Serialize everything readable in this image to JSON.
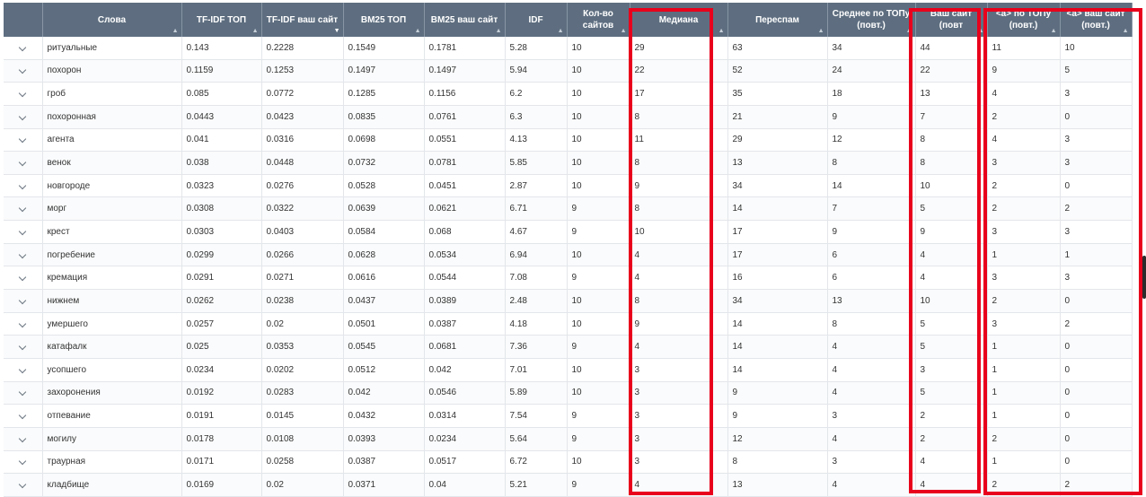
{
  "table": {
    "columns": [
      {
        "key": "expand",
        "label": ""
      },
      {
        "key": "word",
        "label": "Слова"
      },
      {
        "key": "tfidf_top",
        "label": "TF-IDF ТОП"
      },
      {
        "key": "tfidf_site",
        "label": "TF-IDF ваш сайт"
      },
      {
        "key": "bm25_top",
        "label": "BM25 ТОП"
      },
      {
        "key": "bm25_site",
        "label": "BM25 ваш сайт"
      },
      {
        "key": "idf",
        "label": "IDF"
      },
      {
        "key": "sites",
        "label": "Кол-во сайтов"
      },
      {
        "key": "median",
        "label": "Медиана"
      },
      {
        "key": "spam",
        "label": "Переспам"
      },
      {
        "key": "avg_top",
        "label": "Среднее по ТОПу (повт.)"
      },
      {
        "key": "your_site",
        "label": "Ваш сайт (повт"
      },
      {
        "key": "a_top",
        "label": "<a> по ТОПу (повт.)"
      },
      {
        "key": "a_site",
        "label": "<a> ваш сайт (повт.)"
      }
    ],
    "sorted_column": "tfidf_site",
    "rows": [
      [
        "ритуальные",
        "0.143",
        "0.2228",
        "0.1549",
        "0.1781",
        "5.28",
        "10",
        "29",
        "63",
        "34",
        "44",
        "11",
        "10"
      ],
      [
        "похорон",
        "0.1159",
        "0.1253",
        "0.1497",
        "0.1497",
        "5.94",
        "10",
        "22",
        "52",
        "24",
        "22",
        "9",
        "5"
      ],
      [
        "гроб",
        "0.085",
        "0.0772",
        "0.1285",
        "0.1156",
        "6.2",
        "10",
        "17",
        "35",
        "18",
        "13",
        "4",
        "3"
      ],
      [
        "похоронная",
        "0.0443",
        "0.0423",
        "0.0835",
        "0.0761",
        "6.3",
        "10",
        "8",
        "21",
        "9",
        "7",
        "2",
        "0"
      ],
      [
        "агента",
        "0.041",
        "0.0316",
        "0.0698",
        "0.0551",
        "4.13",
        "10",
        "11",
        "29",
        "12",
        "8",
        "4",
        "3"
      ],
      [
        "венок",
        "0.038",
        "0.0448",
        "0.0732",
        "0.0781",
        "5.85",
        "10",
        "8",
        "13",
        "8",
        "8",
        "3",
        "3"
      ],
      [
        "новгороде",
        "0.0323",
        "0.0276",
        "0.0528",
        "0.0451",
        "2.87",
        "10",
        "9",
        "34",
        "14",
        "10",
        "2",
        "0"
      ],
      [
        "морг",
        "0.0308",
        "0.0322",
        "0.0639",
        "0.0621",
        "6.71",
        "9",
        "8",
        "14",
        "7",
        "5",
        "2",
        "2"
      ],
      [
        "крест",
        "0.0303",
        "0.0403",
        "0.0584",
        "0.068",
        "4.67",
        "9",
        "10",
        "17",
        "9",
        "9",
        "3",
        "3"
      ],
      [
        "погребение",
        "0.0299",
        "0.0266",
        "0.0628",
        "0.0534",
        "6.94",
        "10",
        "4",
        "17",
        "6",
        "4",
        "1",
        "1"
      ],
      [
        "кремация",
        "0.0291",
        "0.0271",
        "0.0616",
        "0.0544",
        "7.08",
        "9",
        "4",
        "16",
        "6",
        "4",
        "3",
        "3"
      ],
      [
        "нижнем",
        "0.0262",
        "0.0238",
        "0.0437",
        "0.0389",
        "2.48",
        "10",
        "8",
        "34",
        "13",
        "10",
        "2",
        "0"
      ],
      [
        "умершего",
        "0.0257",
        "0.02",
        "0.0501",
        "0.0387",
        "4.18",
        "10",
        "9",
        "14",
        "8",
        "5",
        "3",
        "2"
      ],
      [
        "катафалк",
        "0.025",
        "0.0353",
        "0.0545",
        "0.0681",
        "7.36",
        "9",
        "4",
        "14",
        "4",
        "5",
        "1",
        "0"
      ],
      [
        "усопшего",
        "0.0234",
        "0.0202",
        "0.0512",
        "0.042",
        "7.01",
        "10",
        "3",
        "14",
        "4",
        "3",
        "1",
        "0"
      ],
      [
        "захоронения",
        "0.0192",
        "0.0283",
        "0.042",
        "0.0546",
        "5.89",
        "10",
        "3",
        "9",
        "4",
        "5",
        "1",
        "0"
      ],
      [
        "отпевание",
        "0.0191",
        "0.0145",
        "0.0432",
        "0.0314",
        "7.54",
        "9",
        "3",
        "9",
        "3",
        "2",
        "1",
        "0"
      ],
      [
        "могилу",
        "0.0178",
        "0.0108",
        "0.0393",
        "0.0234",
        "5.64",
        "9",
        "3",
        "12",
        "4",
        "2",
        "2",
        "0"
      ],
      [
        "траурная",
        "0.0171",
        "0.0258",
        "0.0387",
        "0.0517",
        "6.72",
        "10",
        "3",
        "8",
        "3",
        "4",
        "1",
        "0"
      ],
      [
        "кладбище",
        "0.0169",
        "0.02",
        "0.0371",
        "0.04",
        "5.21",
        "9",
        "4",
        "13",
        "4",
        "4",
        "2",
        "2"
      ]
    ]
  },
  "colors": {
    "header_bg": "#5e6e80",
    "highlight": "#e8001c"
  },
  "icons": {
    "expand": "chevron-down-icon",
    "sort": "sort-arrow-icon"
  }
}
